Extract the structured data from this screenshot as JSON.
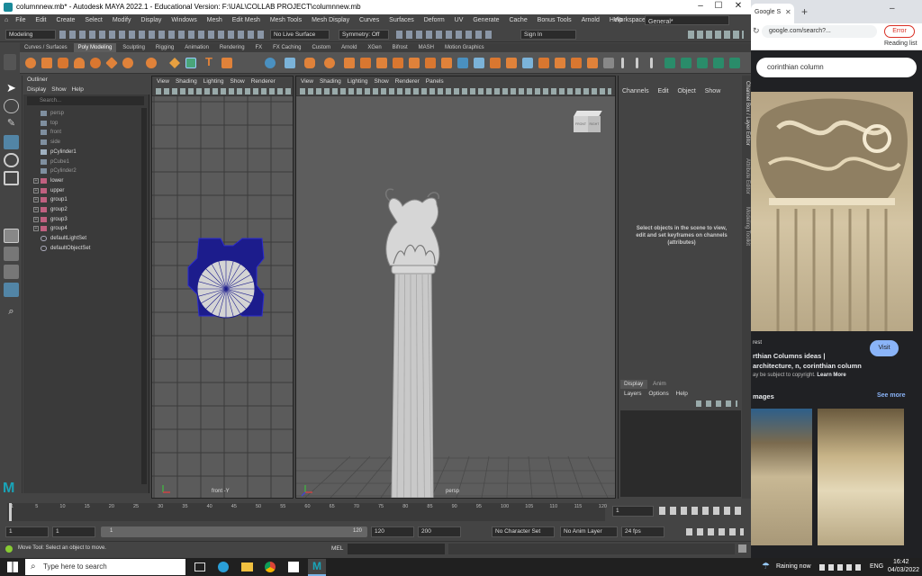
{
  "maya": {
    "title": "columnnew.mb* - Autodesk MAYA 2022.1 - Educational Version: F:\\UAL\\COLLAB PROJECT\\columnnew.mb",
    "menus": [
      "File",
      "Edit",
      "Create",
      "Select",
      "Modify",
      "Display",
      "Windows",
      "Mesh",
      "Edit Mesh",
      "Mesh Tools",
      "Mesh Display",
      "Curves",
      "Surfaces",
      "Deform",
      "UV",
      "Generate",
      "Cache",
      "Bonus Tools",
      "Arnold",
      "Help"
    ],
    "workspace_label": "Workspace:",
    "workspace_value": "General*",
    "menuset": "Modeling",
    "live_surface": "No Live Surface",
    "symmetry": "Symmetry: Off",
    "sign_in": "Sign In",
    "shelf_tabs": [
      "Curves / Surfaces",
      "Poly Modeling",
      "Sculpting",
      "Rigging",
      "Animation",
      "Rendering",
      "FX",
      "FX Caching",
      "Custom",
      "Arnold",
      "XGen",
      "Bifrost",
      "MASH",
      "Motion Graphics"
    ],
    "active_shelf": "Poly Modeling",
    "outliner": {
      "title": "Outliner",
      "menu": [
        "Display",
        "Show",
        "Help"
      ],
      "search_placeholder": "Search...",
      "items": [
        {
          "name": "persp",
          "dim": true,
          "expand": false
        },
        {
          "name": "top",
          "dim": true,
          "expand": false
        },
        {
          "name": "front",
          "dim": true,
          "expand": false
        },
        {
          "name": "side",
          "dim": true,
          "expand": false
        },
        {
          "name": "pCylinder1",
          "dim": false,
          "expand": false
        },
        {
          "name": "pCube1",
          "dim": true,
          "expand": false
        },
        {
          "name": "pCylinder2",
          "dim": true,
          "expand": false
        },
        {
          "name": "lower",
          "dim": false,
          "expand": true
        },
        {
          "name": "upper",
          "dim": false,
          "expand": true
        },
        {
          "name": "group1",
          "dim": false,
          "expand": true
        },
        {
          "name": "group2",
          "dim": false,
          "expand": true
        },
        {
          "name": "group3",
          "dim": false,
          "expand": true
        },
        {
          "name": "group4",
          "dim": false,
          "expand": true
        },
        {
          "name": "defaultLightSet",
          "dim": false,
          "expand": false
        },
        {
          "name": "defaultObjectSet",
          "dim": false,
          "expand": false
        }
      ]
    },
    "viewport_menu": [
      "View",
      "Shading",
      "Lighting",
      "Show",
      "Renderer"
    ],
    "viewport_menu_persp": [
      "View",
      "Shading",
      "Lighting",
      "Show",
      "Renderer",
      "Panels"
    ],
    "view_front_label": "front -Y",
    "view_persp_label": "persp",
    "viewcube_labels": [
      "FRONT",
      "RIGHT"
    ],
    "channel_menu": [
      "Channels",
      "Edit",
      "Object",
      "Show"
    ],
    "channel_message": "Select objects in the scene to view, edit and set keyframes on channels (attributes)",
    "side_tabs": [
      "Channel Box / Layer Editor",
      "Attribute Editor",
      "Modeling Toolkit"
    ],
    "layer_tabs": [
      "Display",
      "Anim"
    ],
    "layer_menu": [
      "Layers",
      "Options",
      "Help"
    ],
    "time_ticks": [
      "1",
      "5",
      "10",
      "15",
      "20",
      "25",
      "30",
      "35",
      "40",
      "45",
      "50",
      "55",
      "60",
      "65",
      "70",
      "75",
      "80",
      "85",
      "90",
      "95",
      "100",
      "105",
      "110",
      "115",
      "120"
    ],
    "current_frame": "1",
    "range_start": "1",
    "range_start2": "1",
    "range_inner_start": "1",
    "range_inner_end": "120",
    "range_end": "120",
    "range_end2": "200",
    "character_set": "No Character Set",
    "anim_layer": "No Anim Layer",
    "fps": "24 fps",
    "mel_label": "MEL",
    "help_line": "Move Tool: Select an object to move."
  },
  "browser": {
    "tab_title": "Google S",
    "url": "google.com/search?...",
    "error_label": "Error",
    "reading_list": "Reading list",
    "search_query": "corinthian column",
    "result_source": "rest",
    "result_title": "rthian Columns ideas | architecture, n, corinthian column",
    "result_note": "ay be subject to copyright.",
    "learn_more": "Learn More",
    "visit": "Visit",
    "images_heading": "mages",
    "see_more": "See more"
  },
  "taskbar": {
    "search_placeholder": "Type here to search",
    "weather": "Raining now",
    "lang": "ENG",
    "time": "16:42",
    "date": "04/03/2022"
  },
  "colors": {
    "accent": "#3b6ea5",
    "wire": "#1c1c8c",
    "google_blue": "#1a73e8"
  }
}
